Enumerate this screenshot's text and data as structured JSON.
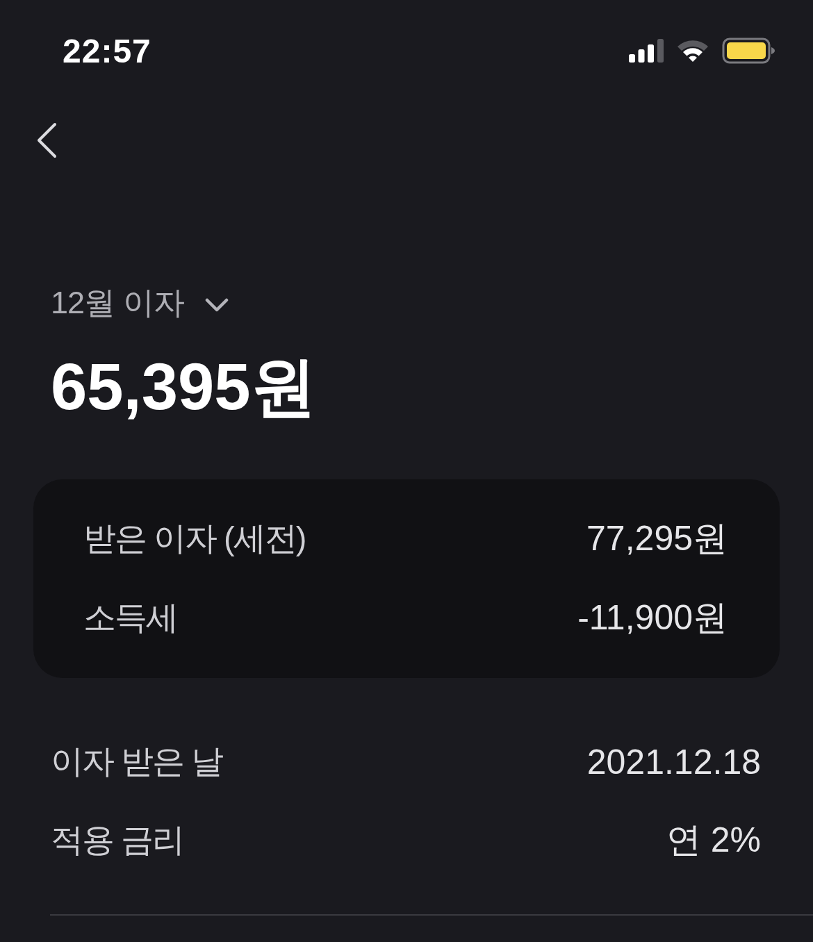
{
  "status_bar": {
    "time": "22:57"
  },
  "header": {
    "title": "12월 이자",
    "amount": "65,395원"
  },
  "breakdown": [
    {
      "label": "받은 이자 (세전)",
      "value": "77,295원"
    },
    {
      "label": "소득세",
      "value": "-11,900원"
    }
  ],
  "details": [
    {
      "label": "이자 받은 날",
      "value": "2021.12.18"
    },
    {
      "label": "적용 금리",
      "value": "연 2%"
    }
  ]
}
